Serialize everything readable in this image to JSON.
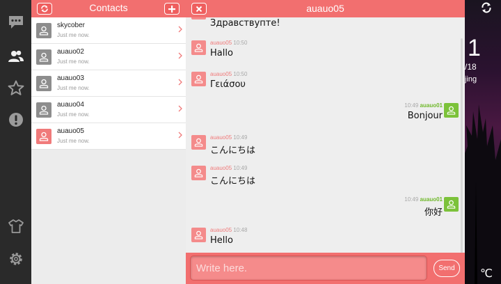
{
  "contacts_panel": {
    "title": "Contacts",
    "items": [
      {
        "name": "skycober",
        "status": "Just me now.",
        "active": false
      },
      {
        "name": "auauo02",
        "status": "Just me now.",
        "active": false
      },
      {
        "name": "auauo03",
        "status": "Just me now.",
        "active": false
      },
      {
        "name": "auauo04",
        "status": "Just me now.",
        "active": false
      },
      {
        "name": "auauo05",
        "status": "Just me now.",
        "active": true
      }
    ]
  },
  "chat": {
    "title": "auauo05",
    "messages": [
      {
        "side": "left",
        "user": "",
        "time": "",
        "text": "Здравствупте!"
      },
      {
        "side": "left",
        "user": "auauo05",
        "time": "10:50",
        "text": "Hallo"
      },
      {
        "side": "left",
        "user": "auauo05",
        "time": "10:50",
        "text": "Γειάσου"
      },
      {
        "side": "right",
        "user": "auauo01",
        "time": "10:49",
        "text": "Bonjour"
      },
      {
        "side": "left",
        "user": "auauo05",
        "time": "10:49",
        "text": "こんにちは"
      },
      {
        "side": "left",
        "user": "auauo05",
        "time": "10:49",
        "text": "こんにちは"
      },
      {
        "side": "right",
        "user": "auauo01",
        "time": "10:49",
        "text": "你好"
      },
      {
        "side": "left",
        "user": "auauo05",
        "time": "10:48",
        "text": "Hello"
      }
    ],
    "input": {
      "placeholder": "Write here.",
      "value": ""
    },
    "send_label": "Send"
  },
  "nav_rail": {
    "icons": [
      "chat-bubble-icon",
      "contacts-icon",
      "star-icon",
      "alert-icon",
      "shirt-icon",
      "settings-gear-icon"
    ]
  },
  "wallpaper": {
    "number": "1",
    "date": "/18",
    "city": "jing",
    "temp_unit": "℃"
  },
  "colors": {
    "accent": "#f26f6f",
    "self_user": "#6fb82a",
    "other_user": "#f07a7a"
  }
}
